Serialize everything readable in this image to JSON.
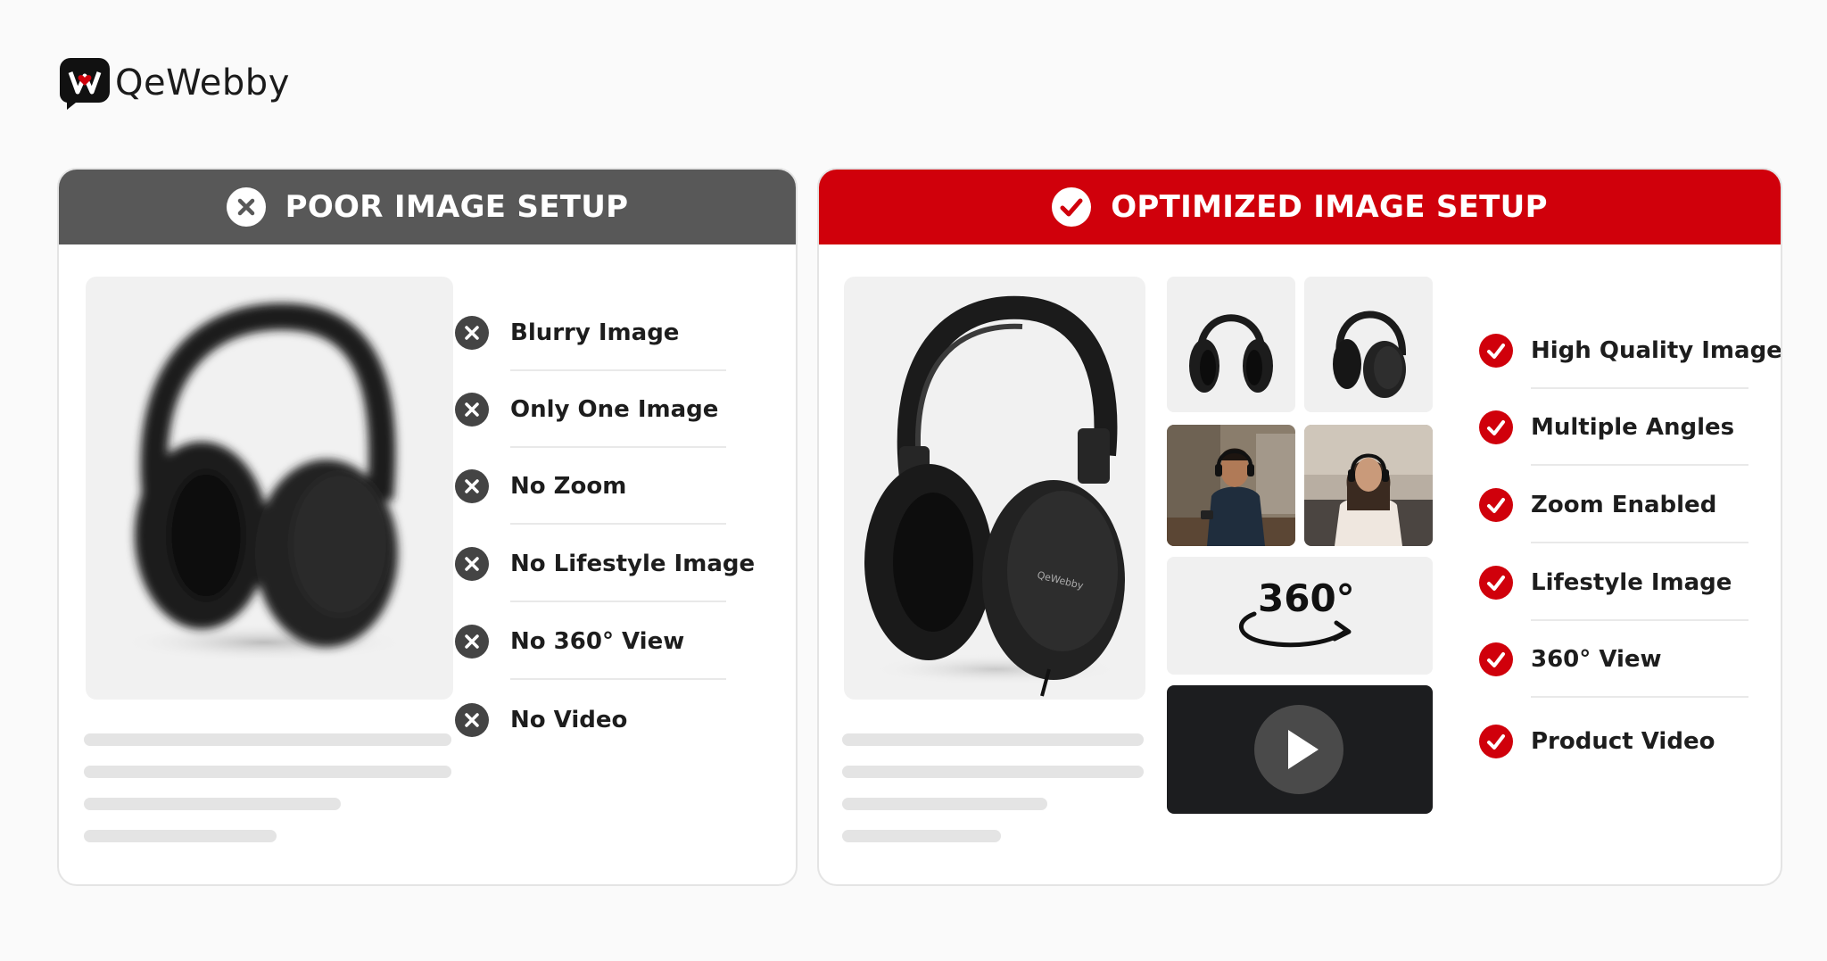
{
  "brand": {
    "name": "QeWebby",
    "logo_icon": "heart-logo-icon"
  },
  "poor": {
    "title": "POOR IMAGE SETUP",
    "icon": "x-circle-icon",
    "header_color": "#585858",
    "items": [
      {
        "label": "Blurry Image"
      },
      {
        "label": "Only One Image"
      },
      {
        "label": "No Zoom"
      },
      {
        "label": "No Lifestyle Image"
      },
      {
        "label": "No 360° View"
      },
      {
        "label": "No Video"
      }
    ]
  },
  "optimized": {
    "title": "OPTIMIZED IMAGE SETUP",
    "icon": "check-circle-icon",
    "header_color": "#d0000b",
    "product_brand": "QeWebby",
    "view_360_label": "360°",
    "items": [
      {
        "label": "High Quality Images"
      },
      {
        "label": "Multiple Angles"
      },
      {
        "label": "Zoom Enabled"
      },
      {
        "label": "Lifestyle Image"
      },
      {
        "label": "360° View"
      },
      {
        "label": "Product Video"
      }
    ]
  }
}
